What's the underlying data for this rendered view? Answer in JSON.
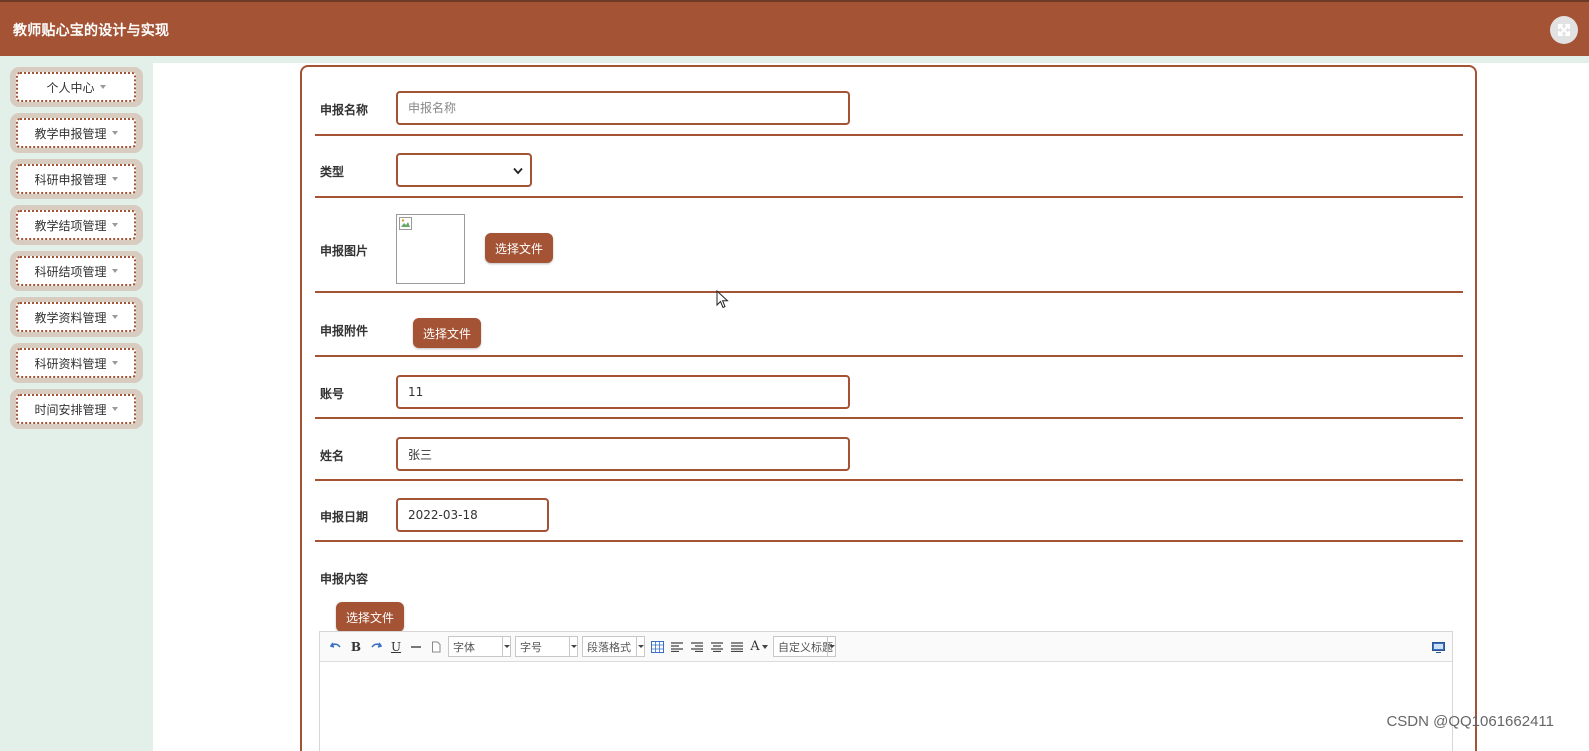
{
  "header": {
    "title": "教师贴心宝的设计与实现"
  },
  "sidebar": {
    "items": [
      {
        "label": "个人中心"
      },
      {
        "label": "教学申报管理"
      },
      {
        "label": "科研申报管理"
      },
      {
        "label": "教学结项管理"
      },
      {
        "label": "科研结项管理"
      },
      {
        "label": "教学资料管理"
      },
      {
        "label": "科研资料管理"
      },
      {
        "label": "时间安排管理"
      }
    ]
  },
  "form": {
    "name": {
      "label": "申报名称",
      "placeholder": "申报名称",
      "value": ""
    },
    "type": {
      "label": "类型",
      "value": ""
    },
    "image": {
      "label": "申报图片",
      "button": "选择文件"
    },
    "attachment": {
      "label": "申报附件",
      "button": "选择文件"
    },
    "account": {
      "label": "账号",
      "value": "11"
    },
    "fullname": {
      "label": "姓名",
      "value": "张三"
    },
    "date": {
      "label": "申报日期",
      "value": "2022-03-18"
    },
    "content": {
      "label": "申报内容",
      "button": "选择文件"
    }
  },
  "editor": {
    "font_family": "字体",
    "font_size": "字号",
    "paragraph": "段落格式",
    "custom_title": "自定义标题"
  },
  "watermark": "CSDN @QQ1061662411",
  "colors": {
    "accent": "#a45334",
    "sidebar_bg": "#e3efe9"
  }
}
